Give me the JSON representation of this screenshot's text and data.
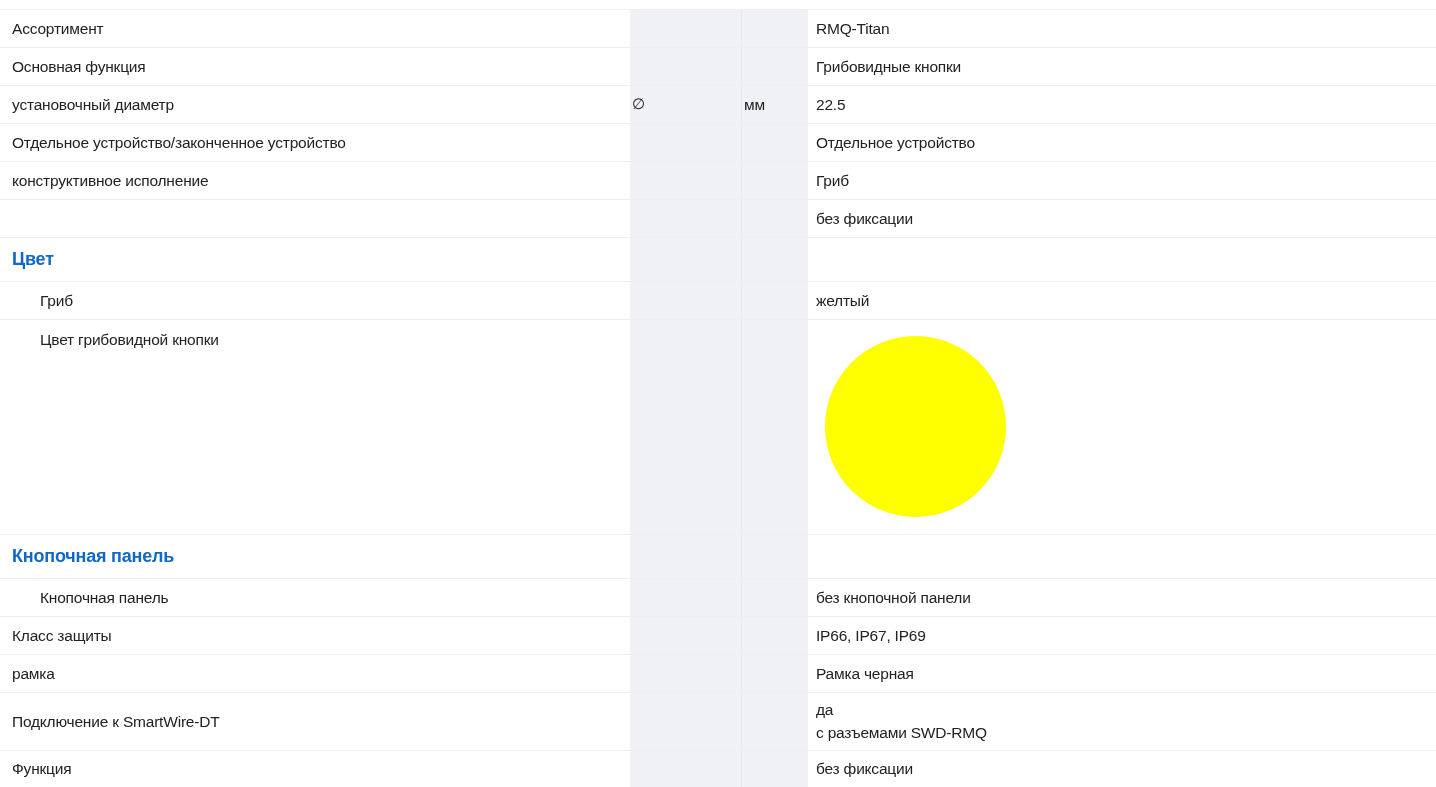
{
  "rows": [
    {
      "kind": "row",
      "label": "Ассортимент",
      "value": "RMQ-Titan"
    },
    {
      "kind": "row",
      "label": "Основная функция",
      "value": "Грибовидные кнопки"
    },
    {
      "kind": "row",
      "label": "установочный диаметр",
      "symbol": "∅",
      "unit": "мм",
      "value": "22.5"
    },
    {
      "kind": "row",
      "label": "Отдельное устройство/законченное устройство",
      "value": "Отдельное устройство"
    },
    {
      "kind": "row",
      "label": "конструктивное исполнение",
      "value": "Гриб"
    },
    {
      "kind": "row",
      "value": "без фиксации"
    },
    {
      "kind": "section",
      "title": "Цвет",
      "children": [
        {
          "kind": "row",
          "label": "Гриб",
          "value": "желтый"
        },
        {
          "kind": "swatch",
          "label": "Цвет грибовидной кнопки",
          "color": "#ffff00"
        }
      ]
    },
    {
      "kind": "section",
      "title": "Кнопочная панель",
      "children": [
        {
          "kind": "row",
          "label": "Кнопочная панель",
          "value": "без кнопочной панели"
        }
      ]
    },
    {
      "kind": "row",
      "label": "Класс защиты",
      "value": "IP66, IP67, IP69"
    },
    {
      "kind": "row",
      "label": "рамка",
      "value": "Рамка черная"
    },
    {
      "kind": "row",
      "label": "Подключение к SmartWire-DT",
      "value": "да\nс разъемами SWD-RMQ"
    },
    {
      "kind": "row",
      "label": "Функция",
      "value": "без фиксации"
    }
  ]
}
